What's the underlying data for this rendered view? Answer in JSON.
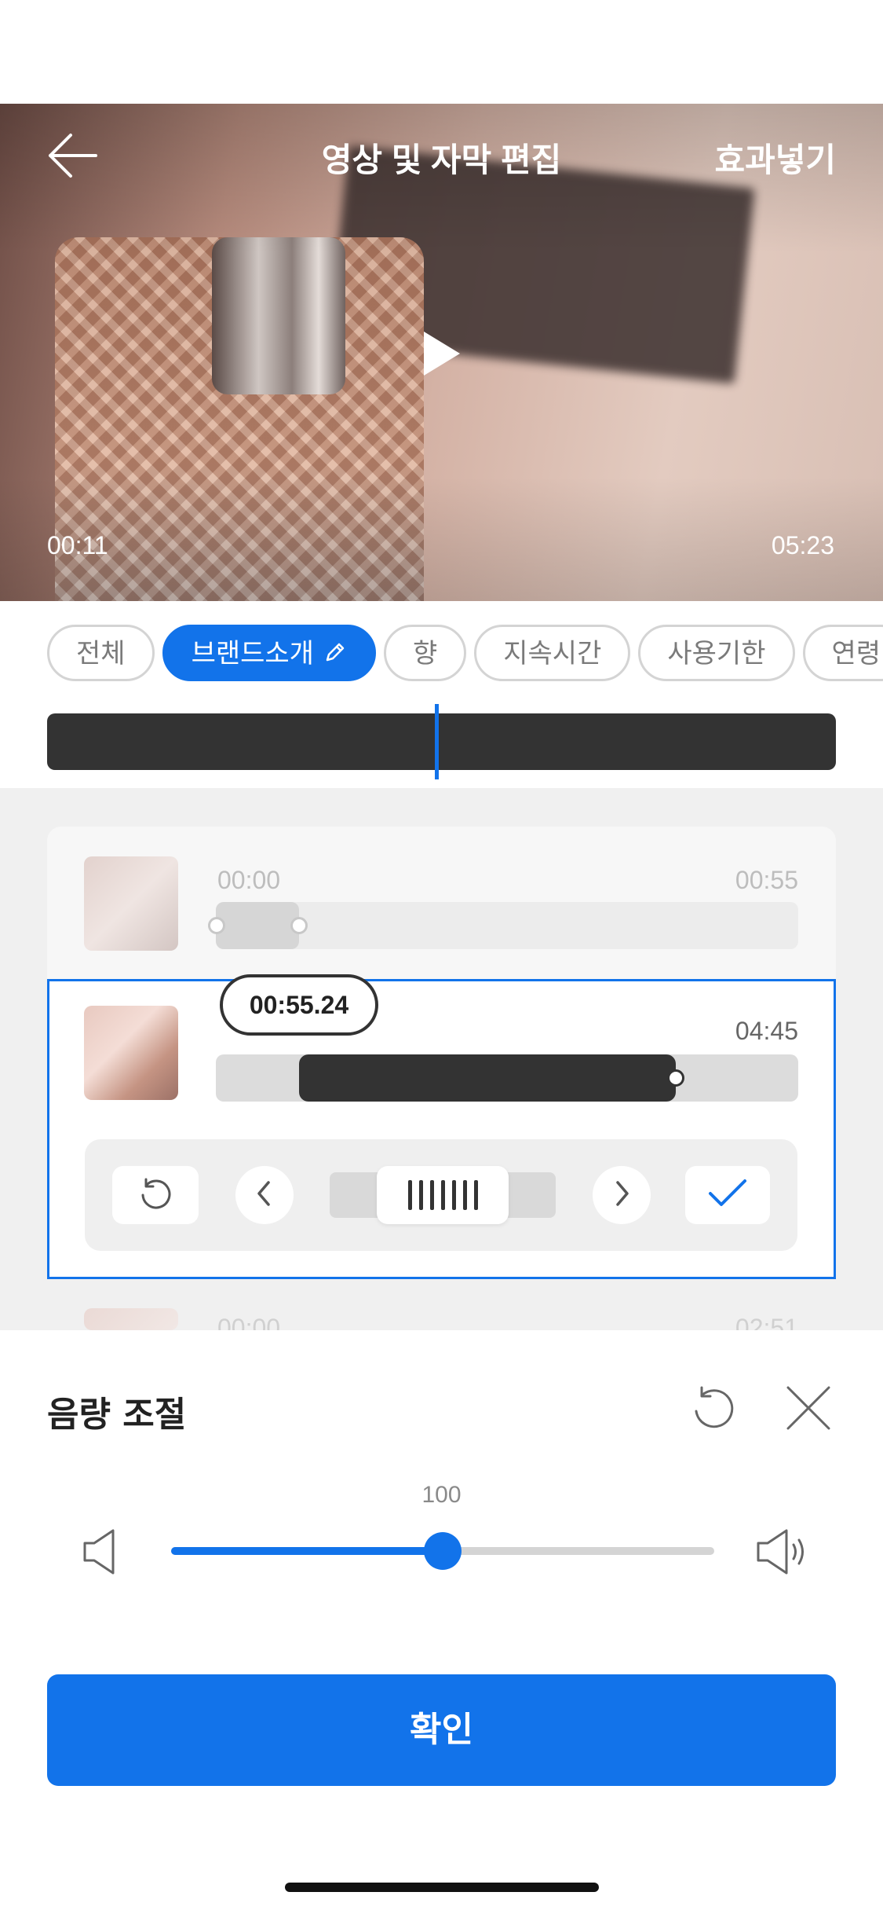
{
  "header": {
    "title": "영상 및 자막 편집",
    "effects_label": "효과넣기",
    "current_time": "00:11",
    "total_time": "05:23"
  },
  "chips": [
    {
      "label": "전체",
      "active": false
    },
    {
      "label": "브랜드소개",
      "active": true
    },
    {
      "label": "향",
      "active": false
    },
    {
      "label": "지속시간",
      "active": false
    },
    {
      "label": "사용기한",
      "active": false
    },
    {
      "label": "연령",
      "active": false
    }
  ],
  "clips": [
    {
      "start": "00:00",
      "end": "00:55"
    },
    {
      "bubble_time": "00:55.24",
      "end": "04:45"
    },
    {
      "start": "00:00",
      "end": "02:51"
    }
  ],
  "volume": {
    "title": "음량 조절",
    "value": "100",
    "level_fraction": 0.5
  },
  "confirm_label": "확인",
  "colors": {
    "accent": "#1273ea",
    "dark": "#333333"
  }
}
